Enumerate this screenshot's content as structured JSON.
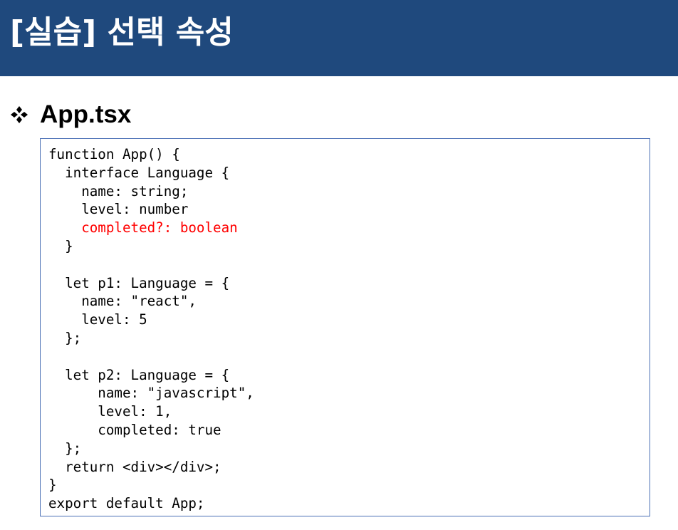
{
  "slide": {
    "title": "[실습] 선택 속성",
    "section_heading": "App.tsx",
    "bullet_icon": "four-diamond-bullet-icon",
    "colors": {
      "title_bar": "#1f497d",
      "title_text": "#ffffff",
      "code_border": "#4a6fb5",
      "highlight": "#ff0000"
    }
  },
  "code": {
    "lines": [
      {
        "text": "function App() {",
        "highlight": false
      },
      {
        "text": "  interface Language {",
        "highlight": false
      },
      {
        "text": "    name: string;",
        "highlight": false
      },
      {
        "text": "    level: number",
        "highlight": false
      },
      {
        "text": "    completed?: boolean",
        "highlight": true
      },
      {
        "text": "  }",
        "highlight": false
      },
      {
        "text": "",
        "highlight": false
      },
      {
        "text": "  let p1: Language = {",
        "highlight": false
      },
      {
        "text": "    name: \"react\",",
        "highlight": false
      },
      {
        "text": "    level: 5",
        "highlight": false
      },
      {
        "text": "  };",
        "highlight": false
      },
      {
        "text": "",
        "highlight": false
      },
      {
        "text": "  let p2: Language = {",
        "highlight": false
      },
      {
        "text": "      name: \"javascript\",",
        "highlight": false
      },
      {
        "text": "      level: 1,",
        "highlight": false
      },
      {
        "text": "      completed: true",
        "highlight": false
      },
      {
        "text": "  };",
        "highlight": false
      },
      {
        "text": "  return <div></div>;",
        "highlight": false
      },
      {
        "text": "}",
        "highlight": false
      },
      {
        "text": "export default App;",
        "highlight": false
      }
    ]
  }
}
